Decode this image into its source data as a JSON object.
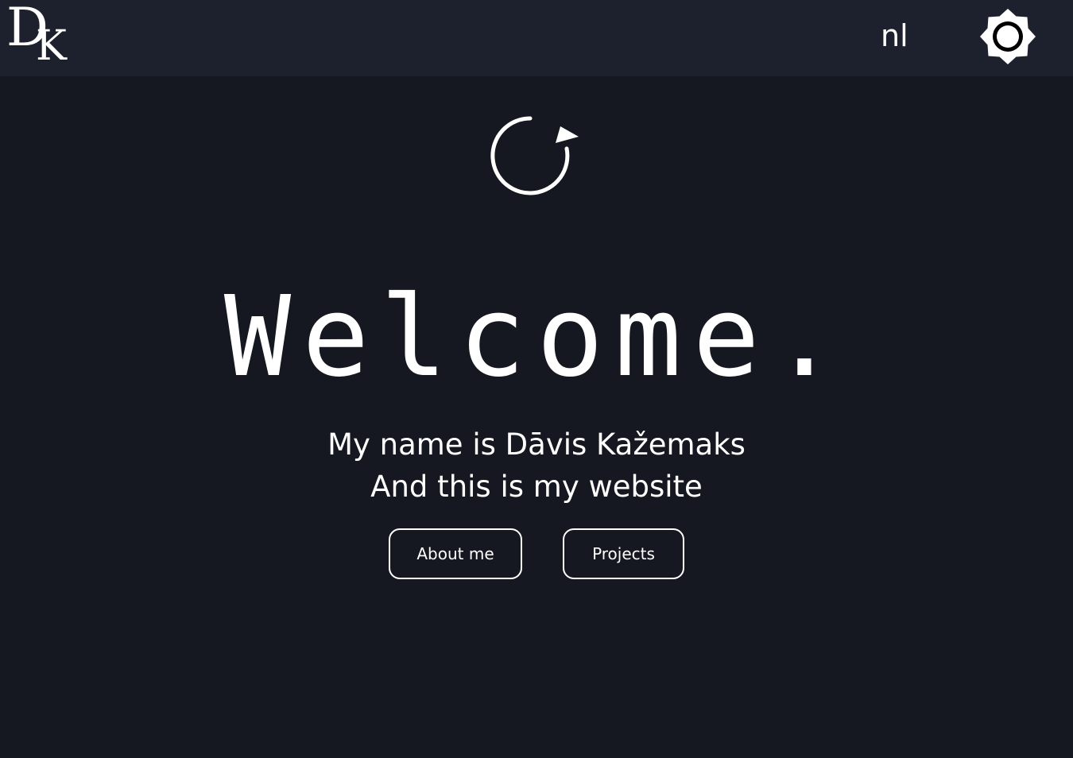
{
  "header": {
    "logo": {
      "letter_d": "D",
      "letter_k": "K"
    },
    "language_label": "nl",
    "theme_toggle_icon": "brightness-icon"
  },
  "hero": {
    "reload_icon": "reload-icon",
    "heading": "Welcome.",
    "line1": "My name is Dāvis Kažemaks",
    "line2": "And this is my website",
    "buttons": {
      "about": "About me",
      "projects": "Projects"
    }
  },
  "colors": {
    "background": "#151820",
    "navbar": "#1d212d",
    "foreground": "#ffffff"
  }
}
